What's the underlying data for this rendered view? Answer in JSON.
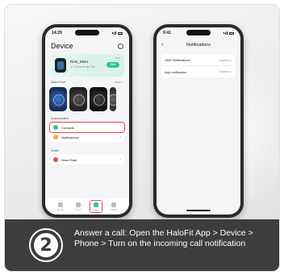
{
  "left_phone": {
    "time": "14:29",
    "title": "Device",
    "device_card": {
      "name": "Relo_D661",
      "meta": "● Connected  ▮ 70%",
      "button": "Bind",
      "pct": "70%"
    },
    "watch_face_label": "Watch Face",
    "watch_face_more": "More >",
    "customization_label": "Customization",
    "items": [
      {
        "label": "Contacts",
        "color": "#2fc58e"
      },
      {
        "label": "Notifications",
        "color": "#f2b32a"
      }
    ],
    "health_label": "Health",
    "health_items": [
      {
        "label": "Heart Rate",
        "color": "#e24b4b"
      }
    ],
    "tabs": [
      "Home",
      "Sport",
      "Device",
      "Profile"
    ]
  },
  "right_phone": {
    "time": "9:41",
    "back": "‹",
    "title": "Notifications",
    "rows": [
      {
        "label": "SMS Notifications",
        "value": "Disabled >"
      },
      {
        "label": "App notification",
        "value": "Disabled >"
      }
    ]
  },
  "caption": {
    "step": "2",
    "text": "Answer a call: Open the HaloFit App > Device > Phone > Turn on the incoming call notification"
  },
  "colors": {
    "accent_green": "#2fc58e",
    "highlight_red": "#e24b4b",
    "caption_bg": "#3d3d3d"
  }
}
